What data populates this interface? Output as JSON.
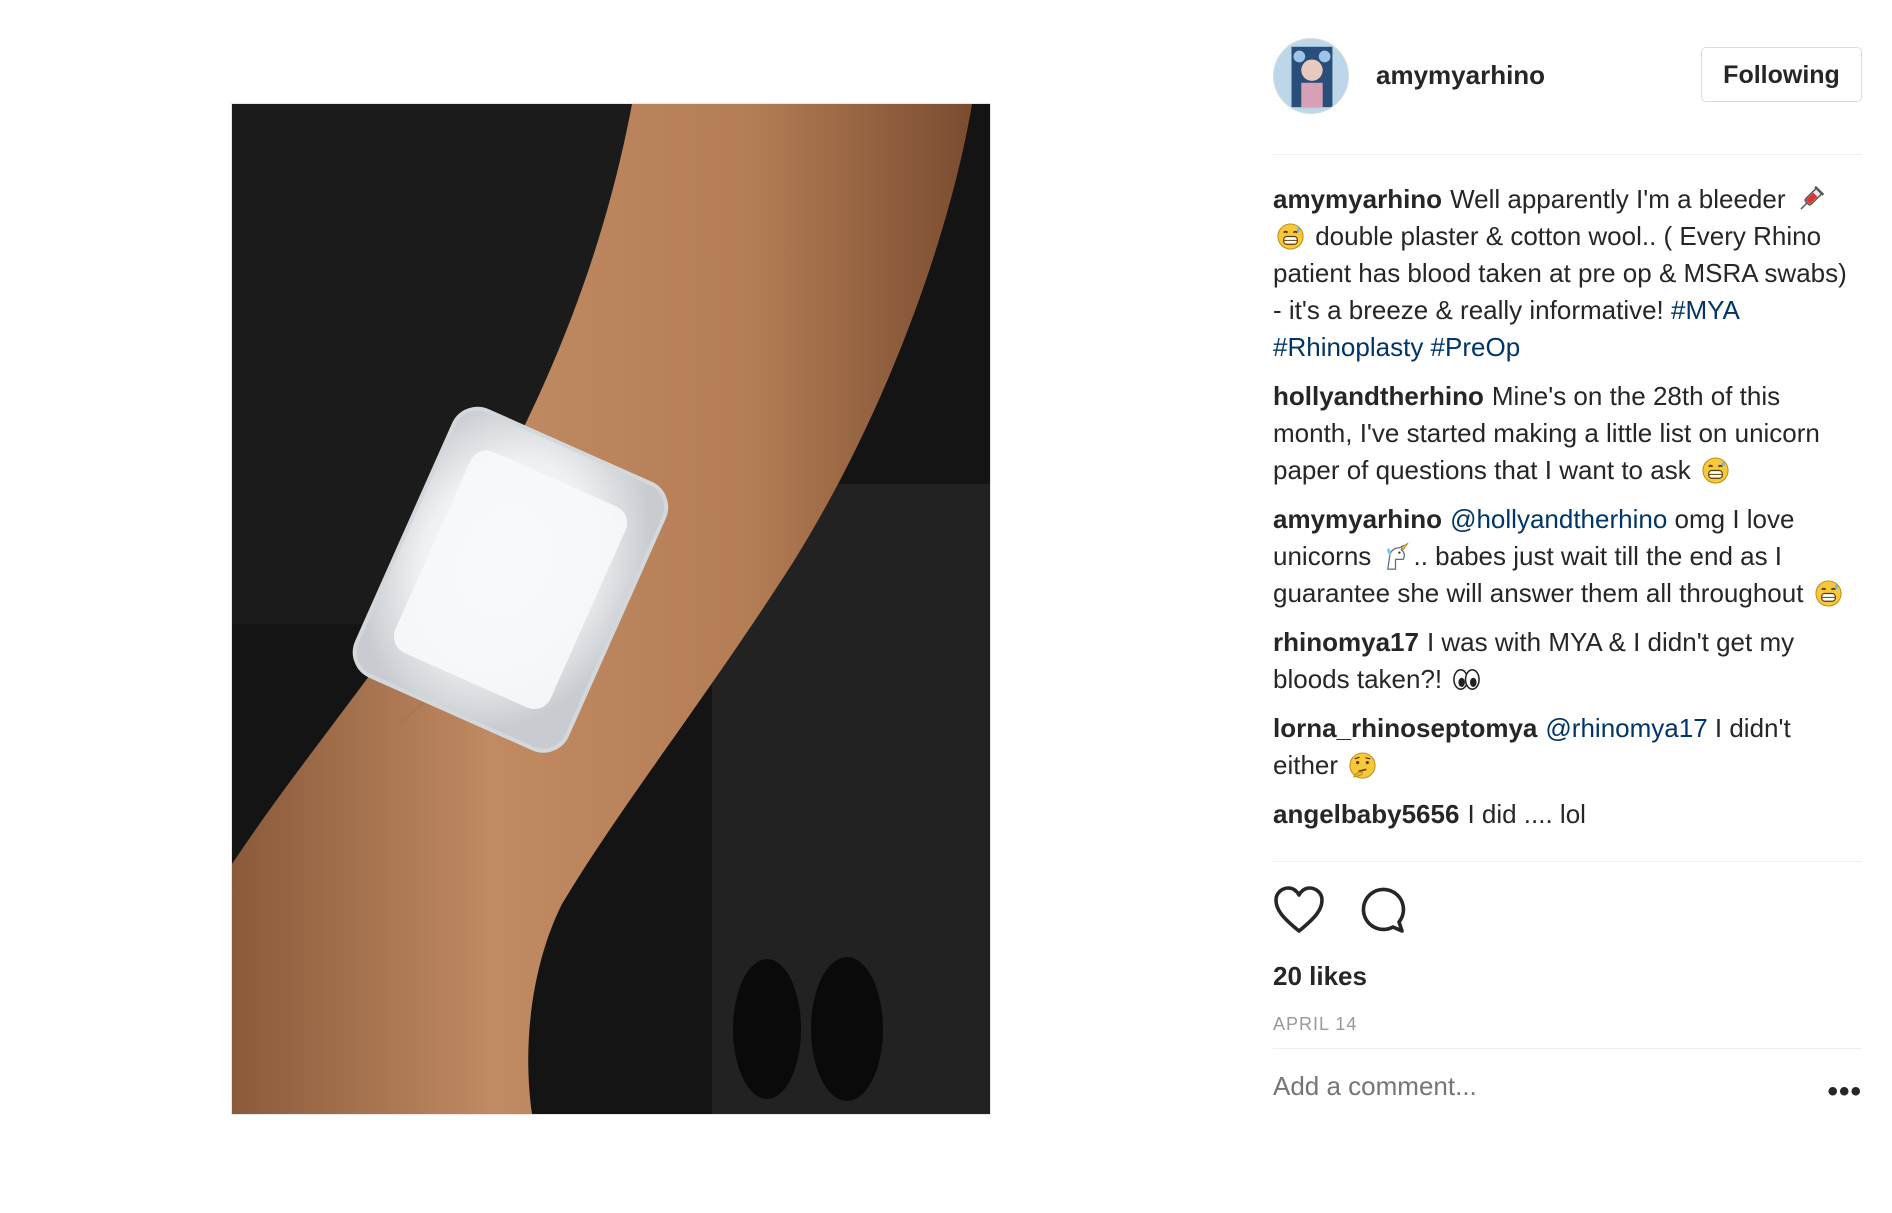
{
  "post": {
    "username": "amymyarhino",
    "follow_label": "Following",
    "comments": [
      {
        "author": "amymyarhino",
        "parts": [
          {
            "type": "text",
            "text": "Well apparently I'm a bleeder "
          },
          {
            "type": "emoji",
            "name": "syringe-icon"
          },
          {
            "type": "emoji",
            "name": "grinning-sweat-icon"
          },
          {
            "type": "text",
            "text": " double plaster & cotton wool.. ( Every Rhino patient has blood taken at pre op & MSRA swabs) - it's a breeze & really informative! "
          },
          {
            "type": "tag",
            "text": "#MYA"
          },
          {
            "type": "text",
            "text": " "
          },
          {
            "type": "tag",
            "text": "#Rhinoplasty"
          },
          {
            "type": "text",
            "text": " "
          },
          {
            "type": "tag",
            "text": "#PreOp"
          }
        ]
      },
      {
        "author": "hollyandtherhino",
        "parts": [
          {
            "type": "text",
            "text": "Mine's on the 28th of this month, I've started making a little list on unicorn paper of questions that I want to ask "
          },
          {
            "type": "emoji",
            "name": "grinning-sweat-icon"
          }
        ]
      },
      {
        "author": "amymyarhino",
        "parts": [
          {
            "type": "mention",
            "text": "@hollyandtherhino"
          },
          {
            "type": "text",
            "text": " omg I love unicorns "
          },
          {
            "type": "emoji",
            "name": "unicorn-icon"
          },
          {
            "type": "text",
            "text": ".. babes just wait till the end as I guarantee she will answer them all throughout "
          },
          {
            "type": "emoji",
            "name": "grinning-sweat-icon"
          }
        ]
      },
      {
        "author": "rhinomya17",
        "parts": [
          {
            "type": "text",
            "text": "I was with MYA & I didn't get my bloods taken?! "
          },
          {
            "type": "emoji",
            "name": "eyes-icon"
          }
        ]
      },
      {
        "author": "lorna_rhinoseptomya",
        "parts": [
          {
            "type": "mention",
            "text": "@rhinomya17"
          },
          {
            "type": "text",
            "text": " I didn't either "
          },
          {
            "type": "emoji",
            "name": "thinking-face-icon"
          }
        ]
      },
      {
        "author": "angelbaby5656",
        "parts": [
          {
            "type": "text",
            "text": "I did .... lol"
          }
        ]
      }
    ],
    "likes": "20 likes",
    "date": "APRIL 14",
    "add_comment_placeholder": "Add a comment...",
    "more_label": "•••"
  },
  "colors": {
    "text": "#262626",
    "link": "#003569",
    "muted": "#999999",
    "border": "#dbdbdb"
  }
}
